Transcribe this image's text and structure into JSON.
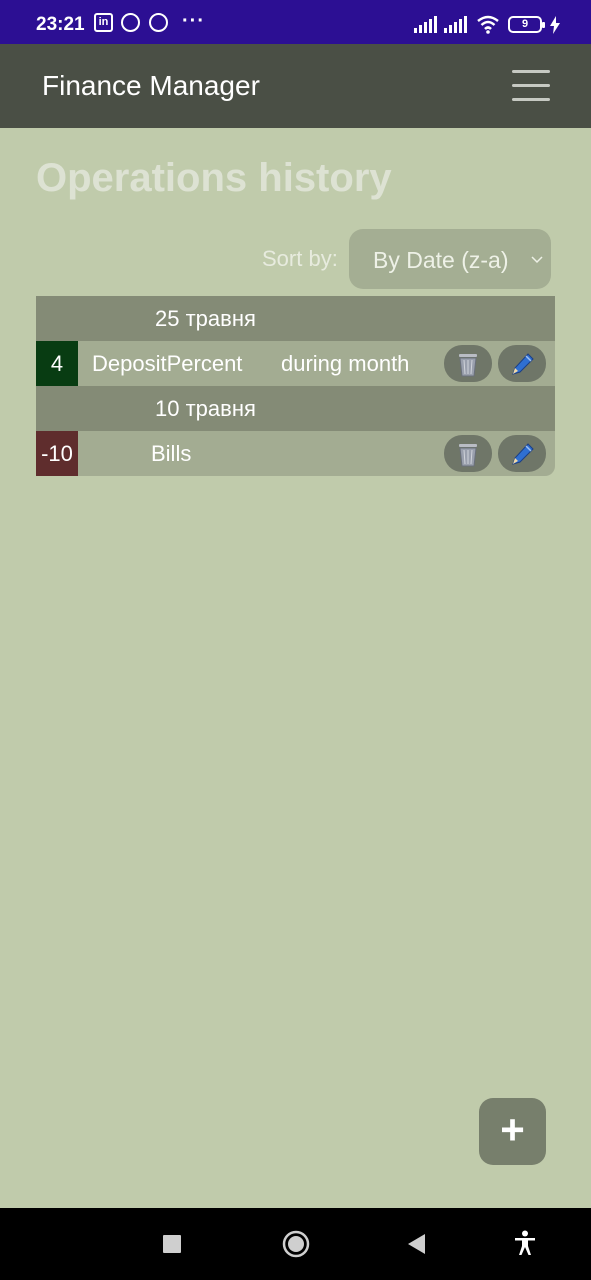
{
  "status_bar": {
    "time": "23:21",
    "linkedin_label": "in",
    "dots": "···",
    "battery": "9"
  },
  "app": {
    "title": "Finance Manager"
  },
  "page": {
    "title": "Operations history",
    "sort_label": "Sort by:",
    "sort_value": "By Date (z-a)"
  },
  "groups": [
    {
      "date": "25 травня",
      "operations": [
        {
          "amount": "4",
          "category": "DepositPercent",
          "comment": "during month",
          "type": "income"
        }
      ]
    },
    {
      "date": "10 травня",
      "operations": [
        {
          "amount": "-10",
          "category": "Bills",
          "comment": "",
          "type": "expense"
        }
      ]
    }
  ],
  "fab": {
    "label": "+"
  },
  "colors": {
    "status_bar": "#2c0f93",
    "app_bar": "#4a4f45",
    "background": "#c0cbab",
    "income": "#083c12",
    "expense": "#5f2d2d"
  }
}
